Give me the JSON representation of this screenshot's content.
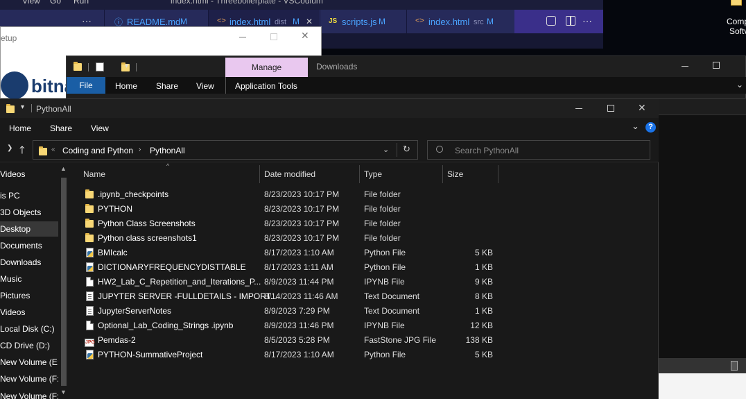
{
  "vscode": {
    "menu": [
      "View",
      "Go",
      "Run"
    ],
    "title": "index.html - Threeboilerplate - VSCodium",
    "more": "⋯",
    "tabs": [
      {
        "icon": "ⓘ",
        "name": "README.md",
        "badge": "M",
        "path": ""
      },
      {
        "icon": "<>",
        "name": "index.html",
        "badge": "M",
        "path": "dist",
        "close": "✕"
      },
      {
        "icon": "JS",
        "name": "scripts.js",
        "badge": "M",
        "path": ""
      },
      {
        "icon": "<>",
        "name": "index.html",
        "badge": "M",
        "path": "src"
      }
    ]
  },
  "desktop": {
    "label1": "Comp",
    "label2": "Softv"
  },
  "setup_window": {
    "title": "etup",
    "logo": "bitna"
  },
  "downloads_window": {
    "title": "Downloads",
    "ribbon_context": "Manage",
    "tabs": [
      "File",
      "Home",
      "Share",
      "View",
      "Application Tools"
    ]
  },
  "explorer": {
    "title": "PythonAll",
    "tabs": [
      "Home",
      "Share",
      "View"
    ],
    "help": "?",
    "breadcrumb": [
      "Coding and Python",
      "PythonAll"
    ],
    "search_placeholder": "Search PythonAll",
    "columns": {
      "name": "Name",
      "date": "Date modified",
      "type": "Type",
      "size": "Size"
    },
    "nav": [
      "Videos",
      "is PC",
      "3D Objects",
      "Desktop",
      "Documents",
      "Downloads",
      "Music",
      "Pictures",
      "Videos",
      "Local Disk (C:)",
      "CD Drive (D:)",
      "New Volume (E:)",
      "New Volume (F:)",
      "New Volume (F:)"
    ],
    "files": [
      {
        "icon": "folder",
        "name": ".ipynb_checkpoints",
        "date": "8/23/2023 10:17 PM",
        "type": "File folder",
        "size": ""
      },
      {
        "icon": "folder",
        "name": "PYTHON",
        "date": "8/23/2023 10:17 PM",
        "type": "File folder",
        "size": ""
      },
      {
        "icon": "folder",
        "name": "Python Class Screenshots",
        "date": "8/23/2023 10:17 PM",
        "type": "File folder",
        "size": ""
      },
      {
        "icon": "folder",
        "name": "Python class screenshots1",
        "date": "8/23/2023 10:17 PM",
        "type": "File folder",
        "size": ""
      },
      {
        "icon": "python",
        "name": "BMIcalc",
        "date": "8/17/2023 1:10 AM",
        "type": "Python File",
        "size": "5 KB"
      },
      {
        "icon": "python",
        "name": "DICTIONARYFREQUENCYDISTTABLE",
        "date": "8/17/2023 1:11 AM",
        "type": "Python File",
        "size": "1 KB"
      },
      {
        "icon": "doc",
        "name": "HW2_Lab_C_Repetition_and_Iterations_P...",
        "date": "8/9/2023 11:44 PM",
        "type": "IPYNB File",
        "size": "9 KB"
      },
      {
        "icon": "text",
        "name": "JUPYTER SERVER -FULLDETAILS - IMPORT...",
        "date": "8/14/2023 11:46 AM",
        "type": "Text Document",
        "size": "8 KB"
      },
      {
        "icon": "text",
        "name": "JupyterServerNotes",
        "date": "8/9/2023 7:29 PM",
        "type": "Text Document",
        "size": "1 KB"
      },
      {
        "icon": "doc",
        "name": "Optional_Lab_Coding_Strings .ipynb",
        "date": "8/9/2023 11:46 PM",
        "type": "IPYNB File",
        "size": "12 KB"
      },
      {
        "icon": "jpg",
        "name": "Pemdas-2",
        "date": "8/5/2023 5:28 PM",
        "type": "FastStone JPG File",
        "size": "138 KB"
      },
      {
        "icon": "python",
        "name": "PYTHON-SummativeProject",
        "date": "8/17/2023 1:10 AM",
        "type": "Python File",
        "size": "5 KB"
      }
    ]
  }
}
